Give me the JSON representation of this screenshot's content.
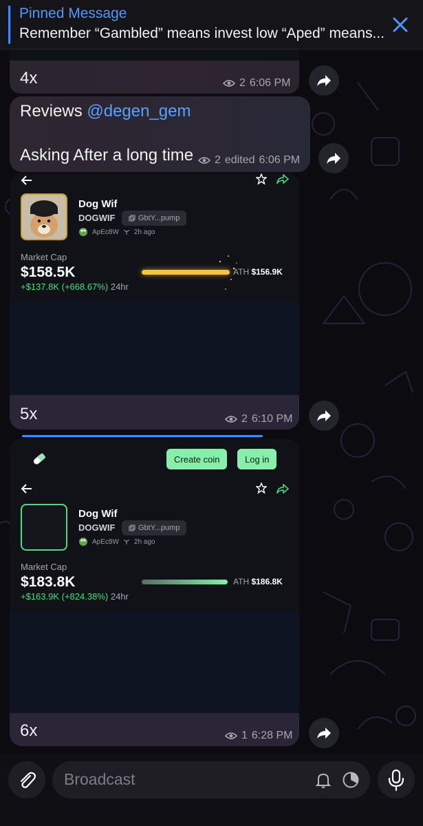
{
  "pinned": {
    "title": "Pinned Message",
    "text": "Remember “Gambled” means invest low “Aped” means..."
  },
  "messages": [
    {
      "text": "4x",
      "views": "2",
      "time": "6:06 PM"
    },
    {
      "text_prefix": "Reviews ",
      "mention": "@degen_gem",
      "text_line2": "Asking After a long time",
      "views": "2",
      "edited": "edited",
      "time": "6:06 PM"
    },
    {
      "text": "5x",
      "views": "2",
      "time": "6:10 PM",
      "card": {
        "coin_name": "Dog Wif",
        "ticker": "DOGWIF",
        "ca": "GbtY...pump",
        "creator": "ApEc8W",
        "age": "2h ago",
        "mc_label": "Market Cap",
        "mc_value": "$158.5K",
        "mc_change": "+$137.8K (+668.67%)",
        "period": "24hr",
        "ath_label": "ATH",
        "ath_value": "$156.9K",
        "ath_progress": 1.0
      }
    },
    {
      "text": "6x",
      "views": "1",
      "time": "6:28 PM",
      "header_buttons": [
        "Create coin",
        "Log in"
      ],
      "card": {
        "coin_name": "Dog Wif",
        "ticker": "DOGWIF",
        "ca": "GbtY...pump",
        "creator": "ApEc8W",
        "age": "2h ago",
        "mc_label": "Market Cap",
        "mc_value": "$183.8K",
        "mc_change": "+$163.9K (+824.38%)",
        "period": "24hr",
        "ath_label": "ATH",
        "ath_value": "$186.8K",
        "ath_progress": 0.98
      }
    }
  ],
  "composer": {
    "placeholder": "Broadcast"
  },
  "colors": {
    "accent": "#4f97ff",
    "green": "#4ade80",
    "gold": "#f5c542",
    "button_green": "#86efac"
  }
}
